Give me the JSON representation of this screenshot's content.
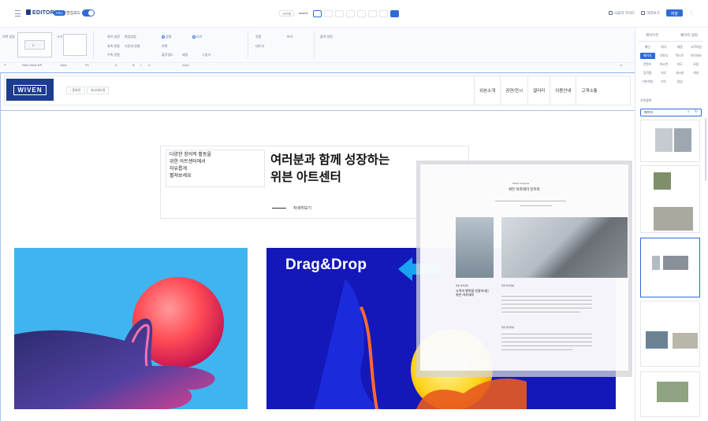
{
  "topbar": {
    "logo": "EDITOR",
    "badge": "PRO",
    "mode_label": "편집모드",
    "mode_on": true,
    "page_label": "서브페",
    "page_name": "asset1",
    "devices": [
      "pc-wide",
      "tablet-l",
      "tablet",
      "tablet-s",
      "mobile-l",
      "mobile",
      "mobile-s",
      "desktop"
    ],
    "links": [
      "사용자 가이드",
      "미리보기"
    ],
    "save": "저장",
    "colors": {
      "accent": "#2e6bd7",
      "brand": "#1b3c8f"
    }
  },
  "toolbar": {
    "row1": [
      "여백 설정",
      "크기",
      "위치 설정",
      "편집방법",
      "정렬",
      "보기",
      "정렬",
      "출력 설정"
    ],
    "row_labels": [
      "좌측 정렬",
      "가운데 정렬",
      "우측 정렬",
      "여백",
      "불투명도",
      "배경",
      "그림자",
      "테두리"
    ],
    "box_center": "0",
    "font_name": "Noto Sans KR",
    "font_size": "16px",
    "line_height": "Px",
    "letter": "22px"
  },
  "site": {
    "logo": "WIVEN",
    "breadcrumbs": [
      "홈화면",
      "회사테마명"
    ],
    "nav": [
      "위븐소개",
      "공연/전시",
      "갤러리",
      "이용안내",
      "고객소통"
    ],
    "hero_small": "다양한 창의적 활동을\n위한 아트센터에서\n자유롭게\n펼쳐보세요",
    "hero_title": "여러분과 함께 성장하는\n위븐 아트센터",
    "hero_more": "자세히보기",
    "dragdrop": "Drag&Drop"
  },
  "preview": {
    "eyebrow": "Wiven Contents",
    "title": "위븐 아카데미 인프라",
    "heading1": "고객의 행복을 만들어내는\n위븐 아카데미",
    "small1": "위븐 아카데미",
    "small2": "위븐 아카데미"
  },
  "rpanel": {
    "tabs": [
      "레이아웃",
      "페이지 설정"
    ],
    "categories": [
      "메인",
      "회사",
      "제품",
      "고객지원",
      "페이지",
      "이미지",
      "텍스트",
      "이미지바",
      "콘텐츠",
      "게시판",
      "지도",
      "모달",
      "입력폼",
      "지도",
      "게시판",
      "섹션",
      "기본섹션",
      "카드",
      "팝업"
    ],
    "active_category": "페이지",
    "section_label": "추천블록",
    "search_value": "페이지"
  }
}
